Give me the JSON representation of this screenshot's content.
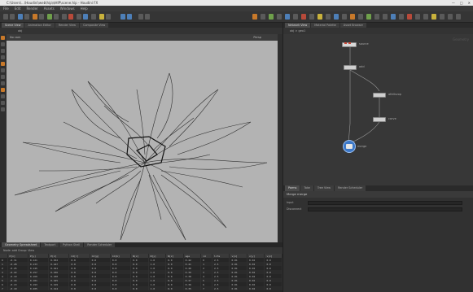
{
  "window": {
    "title": "C:\\Users\\...\\Houdini\\web\\hip\\$HIP\\scene.hip - Houdini FX"
  },
  "menu": [
    "File",
    "Edit",
    "Render",
    "Assets",
    "Windows",
    "Help"
  ],
  "left_tabs": [
    "Scene View",
    "Animation Editor",
    "Render View",
    "Composite View"
  ],
  "path": "obj",
  "viewport": {
    "title": "Persp",
    "camera": "No cam"
  },
  "right_tabs": [
    "Network View",
    "Material Palette",
    "Asset Browser"
  ],
  "network_path": "obj > geo1",
  "watermark": "Geometry",
  "nodes": [
    {
      "label": "source"
    },
    {
      "label": "add"
    },
    {
      "label": "attribvop"
    },
    {
      "label": "carve"
    },
    {
      "label": "merge"
    }
  ],
  "param_tabs": [
    "Parms",
    "Take",
    "Tree View",
    "Render Scheduler"
  ],
  "param_header": "Merge  merge",
  "param_rows": [
    "Input",
    "Disconnect"
  ],
  "sheet_tabs": [
    "Geometry Spreadsheet",
    "Textport",
    "Python Shell",
    "Render Scheduler"
  ],
  "sheet_bar": "Node: add   Group:   View",
  "sheet_columns": [
    "",
    "P[x]",
    "P[y]",
    "P[z]",
    "Cd[r]",
    "Cd[g]",
    "Cd[b]",
    "N[x]",
    "N[y]",
    "N[z]",
    "age",
    "id",
    "life",
    "v[x]",
    "v[y]",
    "v[z]"
  ],
  "sheet_rows": [
    [
      "0",
      "-0.31",
      "0.121",
      "0.452",
      "0.8",
      "0.8",
      "0.8",
      "0.0",
      "1.0",
      "0.0",
      "0.42",
      "0",
      "2.5",
      "0.01",
      "0.02",
      "0.0"
    ],
    [
      "1",
      "-0.28",
      "0.133",
      "0.447",
      "0.8",
      "0.8",
      "0.8",
      "0.0",
      "1.0",
      "0.0",
      "0.41",
      "1",
      "2.5",
      "0.01",
      "0.02",
      "0.0"
    ],
    [
      "2",
      "-0.25",
      "0.145",
      "0.441",
      "0.8",
      "0.8",
      "0.8",
      "0.0",
      "1.0",
      "0.0",
      "0.40",
      "2",
      "2.5",
      "0.01",
      "0.02",
      "0.0"
    ],
    [
      "3",
      "-0.22",
      "0.157",
      "0.436",
      "0.8",
      "0.8",
      "0.8",
      "0.0",
      "1.0",
      "0.0",
      "0.39",
      "3",
      "2.5",
      "0.01",
      "0.02",
      "0.0"
    ],
    [
      "4",
      "-0.19",
      "0.169",
      "0.430",
      "0.8",
      "0.8",
      "0.8",
      "0.0",
      "1.0",
      "0.0",
      "0.38",
      "4",
      "2.5",
      "0.01",
      "0.02",
      "0.0"
    ],
    [
      "5",
      "-0.16",
      "0.181",
      "0.425",
      "0.8",
      "0.8",
      "0.8",
      "0.0",
      "1.0",
      "0.0",
      "0.37",
      "5",
      "2.5",
      "0.01",
      "0.02",
      "0.0"
    ],
    [
      "6",
      "-0.13",
      "0.193",
      "0.419",
      "0.8",
      "0.8",
      "0.8",
      "0.0",
      "1.0",
      "0.0",
      "0.36",
      "6",
      "2.5",
      "0.01",
      "0.02",
      "0.0"
    ],
    [
      "7",
      "-0.10",
      "0.205",
      "0.414",
      "0.8",
      "0.8",
      "0.8",
      "0.0",
      "1.0",
      "0.0",
      "0.35",
      "7",
      "2.5",
      "0.01",
      "0.02",
      "0.0"
    ]
  ],
  "colors": {
    "accent": "#c8792a",
    "selected_node": "#3c78c8"
  }
}
